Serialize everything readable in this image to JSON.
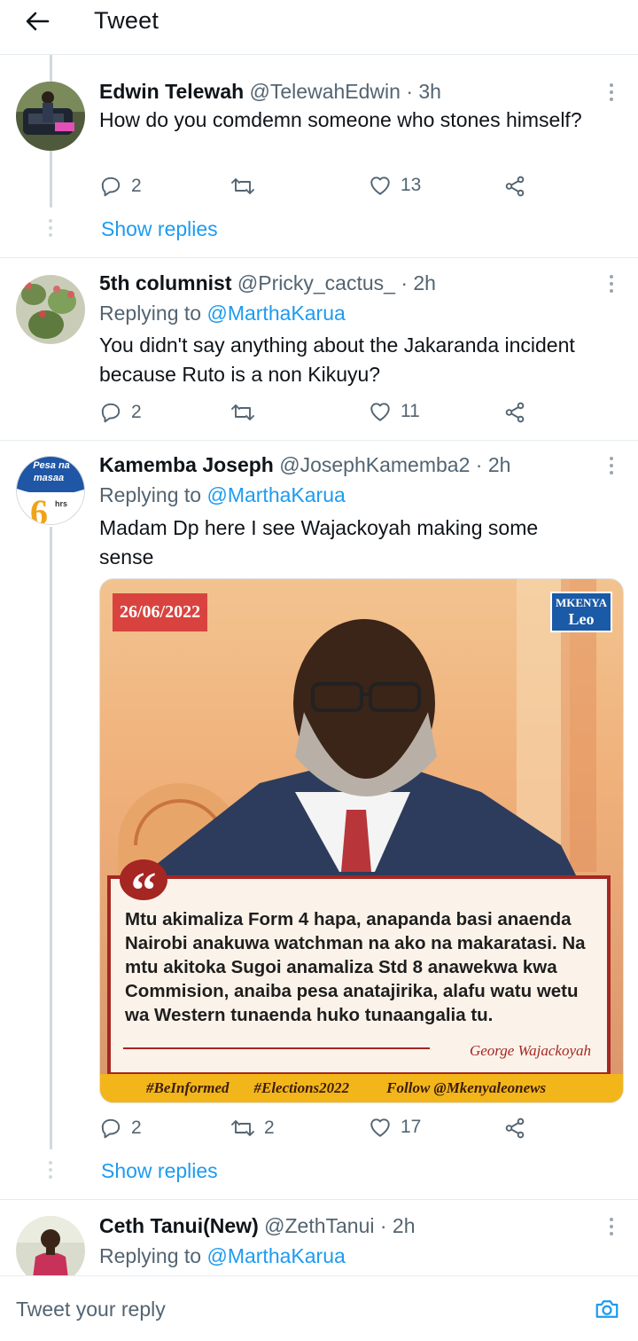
{
  "header": {
    "title": "Tweet",
    "back_icon": "arrow-left-icon"
  },
  "tweets": [
    {
      "name": "Edwin Telewah",
      "handle": "@TelewahEdwin",
      "time": "· 3h",
      "reply_label": "",
      "mention": "",
      "text": "How do you comdemn  someone  who stones himself?",
      "replies": "2",
      "retweets": "",
      "likes": "13",
      "show_replies": "Show replies"
    },
    {
      "name": "5th columnist",
      "handle": "@Pricky_cactus_",
      "time": "· 2h",
      "reply_label": "Replying to",
      "mention": "@MarthaKarua",
      "text": "You didn't say anything about the Jakaranda incident because Ruto is a non Kikuyu?",
      "replies": "2",
      "retweets": "",
      "likes": "11"
    },
    {
      "name": "Kamemba Joseph",
      "handle": "@JosephKamemba2",
      "time": "· 2h",
      "reply_label": "Replying to",
      "mention": "@MarthaKarua",
      "text": "Madam Dp here I see Wajackoyah making some sense",
      "avatar_text": {
        "line1": "Pesa na",
        "line2": "masaa",
        "number": "6",
        "unit": "hrs"
      },
      "replies": "2",
      "retweets": "2",
      "likes": "17",
      "show_replies": "Show replies",
      "media": {
        "date": "26/06/2022",
        "brand_top": "MKENYA",
        "brand_bottom": "Leo",
        "quote": "Mtu akimaliza Form 4 hapa, anapanda basi anaenda Nairobi anakuwa watchman na ako na makaratasi. Na mtu akitoka Sugoi anamaliza Std 8 anawekwa kwa Commision, anaiba pesa anatajirika, alafu watu wetu wa Western tunaenda huko tunaangalia tu.",
        "author": "George Wajackoyah",
        "footer": [
          "#BeInformed",
          "#Elections2022",
          "Follow @Mkenyaleonews"
        ]
      }
    },
    {
      "name": "Ceth Tanui(New)",
      "handle": "@ZethTanui",
      "time": "· 2h",
      "reply_label": "Replying to",
      "mention": "@MarthaKarua"
    }
  ],
  "composer": {
    "placeholder": "Tweet your reply",
    "camera_icon": "camera-icon"
  },
  "colors": {
    "accent": "#1d9bf0",
    "muted": "#536471",
    "divider": "#e6ecf0"
  }
}
